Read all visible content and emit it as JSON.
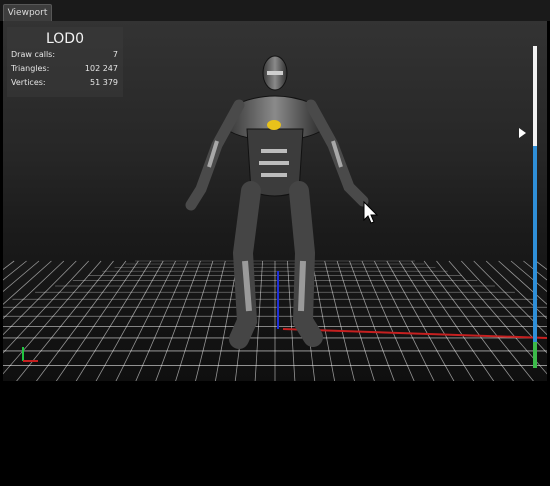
{
  "tab": {
    "label": "Viewport"
  },
  "stats": {
    "lod": "LOD0",
    "rows": [
      {
        "label": "Draw calls:",
        "value": "7"
      },
      {
        "label": "Triangles:",
        "value": "102 247"
      },
      {
        "label": "Vertices:",
        "value": "51 379"
      }
    ]
  },
  "lod_bar": {
    "segments": [
      {
        "name": "lod0",
        "fraction": 0.31,
        "color": "#f2f2f2"
      },
      {
        "name": "lod1",
        "fraction": 0.61,
        "color": "#2f8fd8"
      },
      {
        "name": "lod2",
        "fraction": 0.08,
        "color": "#3cba4a"
      }
    ],
    "current_fraction": 0.27
  },
  "colors": {
    "axis_x": "#c62020",
    "axis_y": "#20c640",
    "axis_z": "#2030d8",
    "grid": "#ffffff"
  },
  "icons": [
    "mouse-cursor-icon",
    "axis-gizmo-icon",
    "lod-marker-icon"
  ]
}
